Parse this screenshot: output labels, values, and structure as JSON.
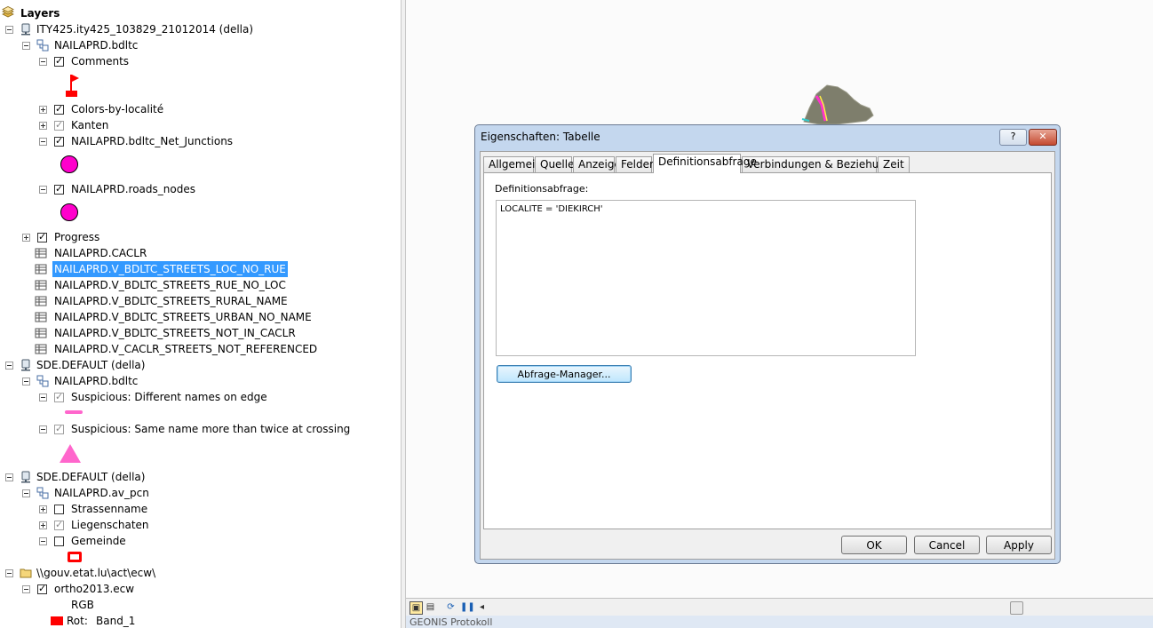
{
  "toc": {
    "header": "Layers",
    "items": [
      {
        "label": "ITY425.ity425_103829_21012014 (della)"
      },
      {
        "label": "NAILAPRD.bdltc"
      },
      {
        "label": "Comments"
      },
      {
        "label": "Colors-by-localité"
      },
      {
        "label": "Kanten"
      },
      {
        "label": "NAILAPRD.bdltc_Net_Junctions"
      },
      {
        "label": "NAILAPRD.roads_nodes"
      },
      {
        "label": "Progress"
      },
      {
        "label": "NAILAPRD.CACLR"
      },
      {
        "label": "NAILAPRD.V_BDLTC_STREETS_LOC_NO_RUE"
      },
      {
        "label": "NAILAPRD.V_BDLTC_STREETS_RUE_NO_LOC"
      },
      {
        "label": "NAILAPRD.V_BDLTC_STREETS_RURAL_NAME"
      },
      {
        "label": "NAILAPRD.V_BDLTC_STREETS_URBAN_NO_NAME"
      },
      {
        "label": "NAILAPRD.V_BDLTC_STREETS_NOT_IN_CACLR"
      },
      {
        "label": "NAILAPRD.V_CACLR_STREETS_NOT_REFERENCED"
      },
      {
        "label": "SDE.DEFAULT (della)"
      },
      {
        "label": "NAILAPRD.bdltc"
      },
      {
        "label": "Suspicious: Different names on edge"
      },
      {
        "label": "Suspicious: Same name more than twice at crossing"
      },
      {
        "label": "SDE.DEFAULT (della)"
      },
      {
        "label": "NAILAPRD.av_pcn"
      },
      {
        "label": "Strassenname"
      },
      {
        "label": "Liegenschaten"
      },
      {
        "label": "Gemeinde"
      },
      {
        "label": "\\\\gouv.etat.lu\\act\\ecw\\"
      },
      {
        "label": "ortho2013.ecw"
      },
      {
        "label": "RGB"
      },
      {
        "label": "Rot:"
      },
      {
        "label": "Band_1"
      }
    ]
  },
  "colors": {
    "selection": "#3399ff",
    "symbol_magenta": "#ff00cc",
    "symbol_pink": "#ff66cc",
    "symbol_red": "#ff0000"
  },
  "dialog": {
    "title": "Eigenschaften: Tabelle",
    "help_label": "?",
    "close_label": "✕",
    "tabs": [
      "Allgemein",
      "Quelle",
      "Anzeige",
      "Felder",
      "Definitionsabfrage",
      "Verbindungen & Beziehungen",
      "Zeit"
    ],
    "active_tab": "Definitionsabfrage",
    "definition_label": "Definitionsabfrage:",
    "definition_query": "LOCALITE = 'DIEKIRCH'",
    "query_manager_label": "Abfrage-Manager...",
    "ok_label": "OK",
    "cancel_label": "Cancel",
    "apply_label": "Apply"
  },
  "statusbar": {
    "bottom_title": "GEONIS Protokoll"
  }
}
